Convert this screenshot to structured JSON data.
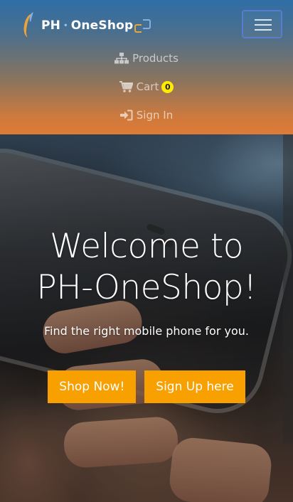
{
  "brand": {
    "name_left": "PH",
    "name_right": "OneShop",
    "separator": "•"
  },
  "navbar": {
    "toggle_icon": "hamburger-menu-icon",
    "items": [
      {
        "label": "Products",
        "icon": "sitemap-icon"
      },
      {
        "label": "Cart",
        "icon": "cart-icon",
        "badge": "0"
      },
      {
        "label": "Sign In",
        "icon": "sign-in-icon"
      }
    ]
  },
  "hero": {
    "title_line1": "Welcome to",
    "title_line2": "PH-OneShop!",
    "subtitle": "Find the right mobile phone for you.",
    "buttons": {
      "shop_now": "Shop Now!",
      "sign_up": "Sign Up here"
    }
  },
  "colors": {
    "accent_orange": "#f7a000",
    "badge_yellow": "#ffeb00",
    "header_top": "#2f6ea6",
    "header_bottom": "#de7b37"
  }
}
